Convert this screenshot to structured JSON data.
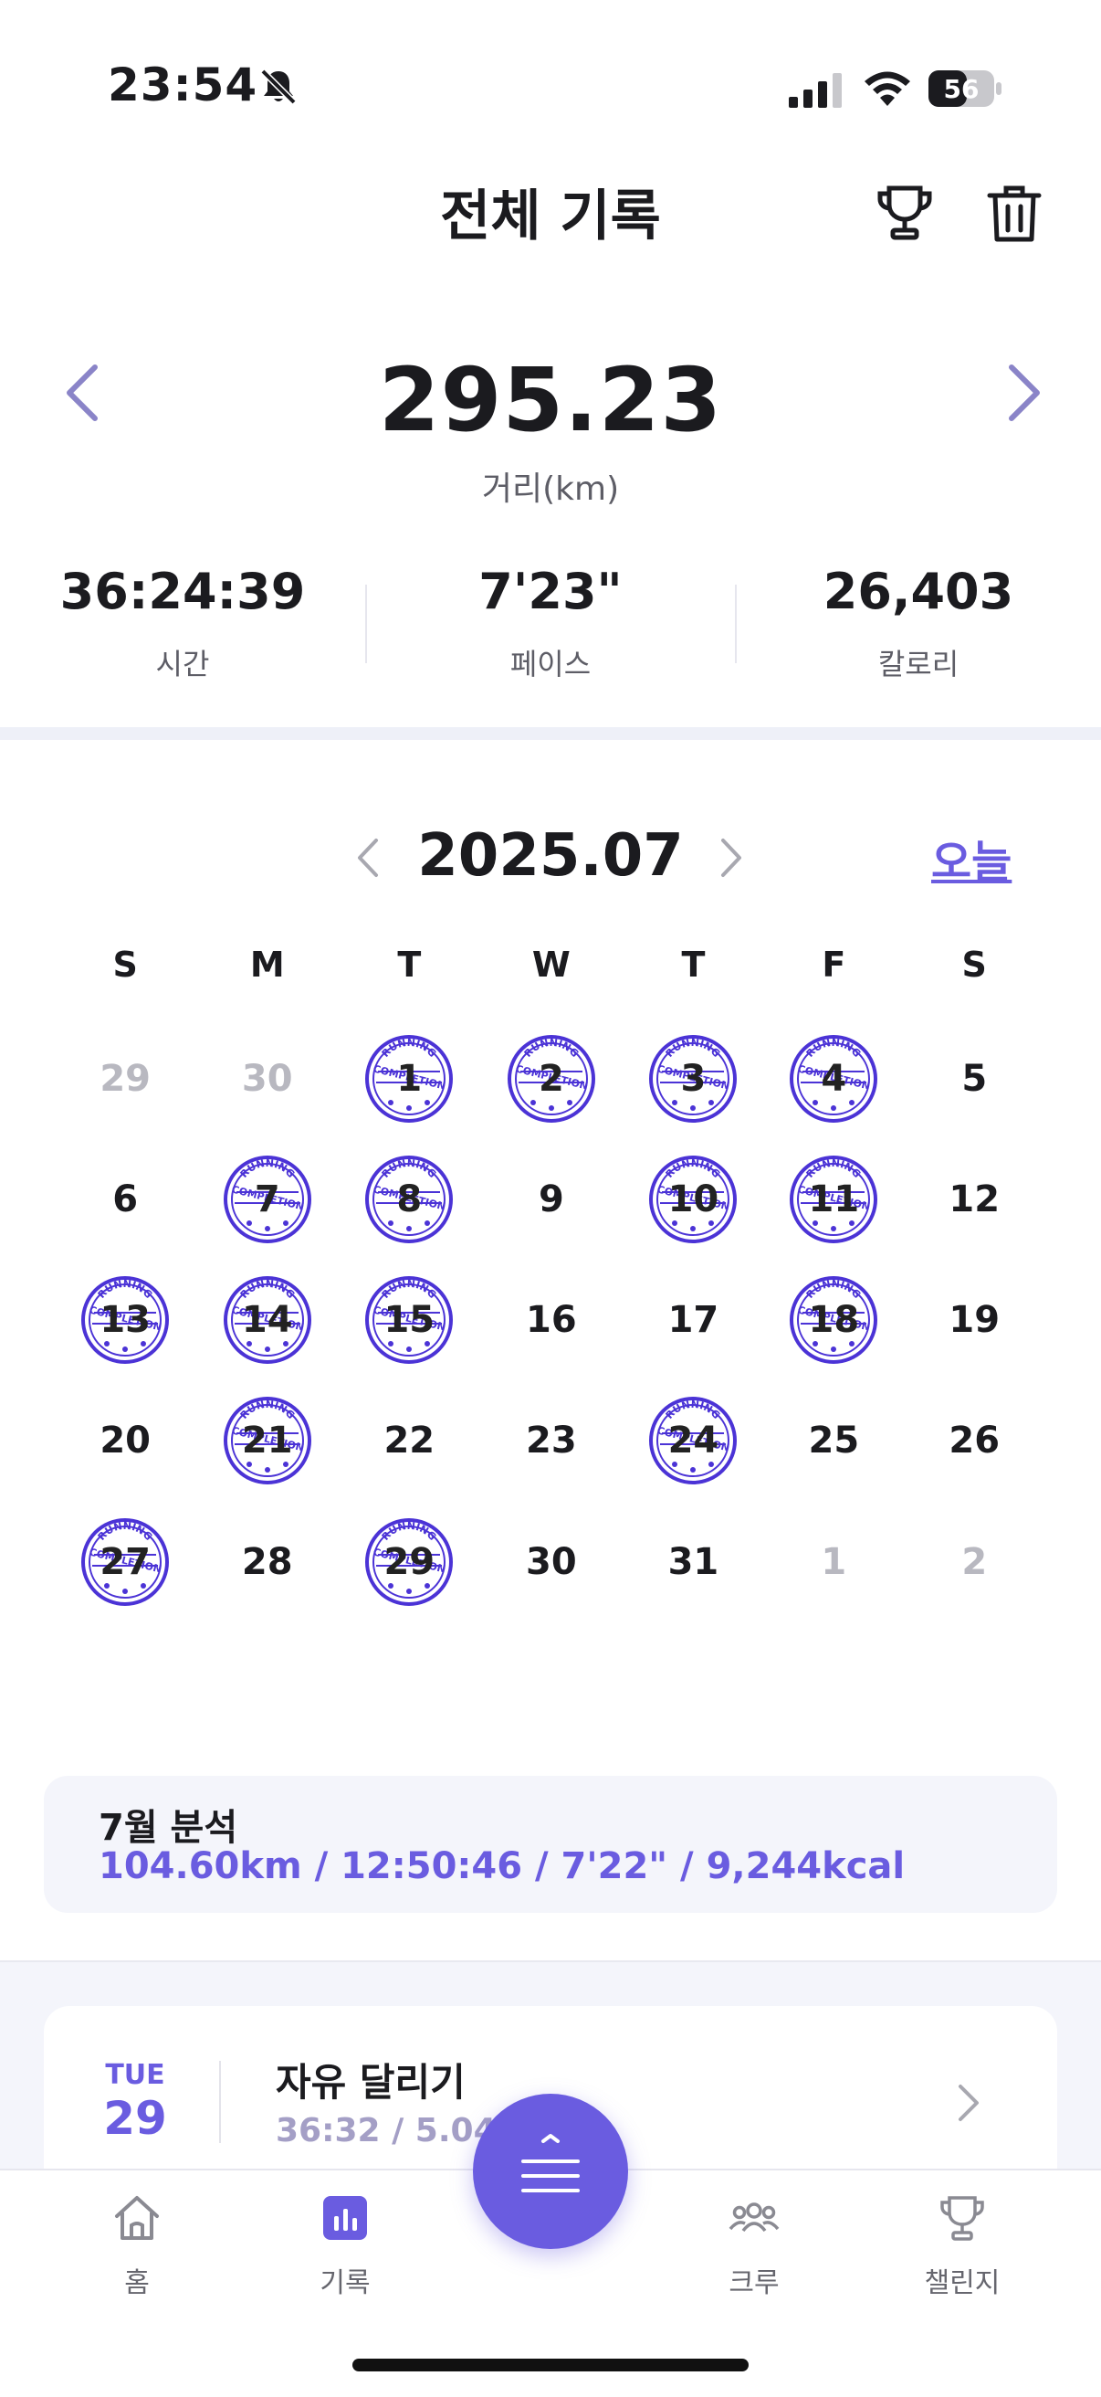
{
  "status_bar": {
    "time": "23:54",
    "battery": "56",
    "icons": [
      "bell-off-icon",
      "signal-icon",
      "wifi-icon",
      "battery-icon"
    ]
  },
  "header": {
    "title": "전체 기록",
    "icons": [
      "trophy-icon",
      "trash-icon"
    ]
  },
  "summary": {
    "distance": "295.23",
    "distance_label": "거리(km)",
    "stats": [
      {
        "value": "36:24:39",
        "label": "시간"
      },
      {
        "value": "7'23\"",
        "label": "페이스"
      },
      {
        "value": "26,403",
        "label": "칼로리"
      }
    ]
  },
  "calendar": {
    "month": "2025.07",
    "today_label": "오늘",
    "weekdays": [
      "S",
      "M",
      "T",
      "W",
      "T",
      "F",
      "S"
    ],
    "stamp_color": "#4b33d6",
    "weeks": [
      [
        {
          "d": "29",
          "muted": true
        },
        {
          "d": "30",
          "muted": true
        },
        {
          "d": "1",
          "stamp": true
        },
        {
          "d": "2",
          "stamp": true
        },
        {
          "d": "3",
          "stamp": true
        },
        {
          "d": "4",
          "stamp": true
        },
        {
          "d": "5"
        }
      ],
      [
        {
          "d": "6"
        },
        {
          "d": "7",
          "stamp": true
        },
        {
          "d": "8",
          "stamp": true
        },
        {
          "d": "9"
        },
        {
          "d": "10",
          "stamp": true
        },
        {
          "d": "11",
          "stamp": true
        },
        {
          "d": "12"
        }
      ],
      [
        {
          "d": "13",
          "stamp": true
        },
        {
          "d": "14",
          "stamp": true
        },
        {
          "d": "15",
          "stamp": true
        },
        {
          "d": "16"
        },
        {
          "d": "17"
        },
        {
          "d": "18",
          "stamp": true
        },
        {
          "d": "19"
        }
      ],
      [
        {
          "d": "20"
        },
        {
          "d": "21",
          "stamp": true
        },
        {
          "d": "22"
        },
        {
          "d": "23"
        },
        {
          "d": "24",
          "stamp": true
        },
        {
          "d": "25"
        },
        {
          "d": "26"
        }
      ],
      [
        {
          "d": "27",
          "stamp": true
        },
        {
          "d": "28"
        },
        {
          "d": "29",
          "stamp": true
        },
        {
          "d": "30"
        },
        {
          "d": "31"
        },
        {
          "d": "1",
          "muted": true
        },
        {
          "d": "2",
          "muted": true
        }
      ]
    ],
    "stamp_text_top": "RUNNING",
    "stamp_text_mid": "COMPLETION"
  },
  "analysis": {
    "title": "7월 분석",
    "values": "104.60km / 12:50:46 / 7'22\" / 9,244kcal"
  },
  "records": [
    {
      "dow": "TUE",
      "day": "29",
      "title": "자유 달리기",
      "stats": "36:32 / 5.04k    5\""
    }
  ],
  "nav": {
    "items": [
      {
        "label": "홈",
        "icon": "home-icon"
      },
      {
        "label": "기록",
        "icon": "chart-icon"
      },
      {
        "label": "크루",
        "icon": "crew-icon"
      },
      {
        "label": "챌린지",
        "icon": "trophy-icon"
      }
    ],
    "fab_icon": "menu-icon"
  },
  "colors": {
    "accent": "#6a5ce0",
    "arrow": "#8a84c8"
  }
}
